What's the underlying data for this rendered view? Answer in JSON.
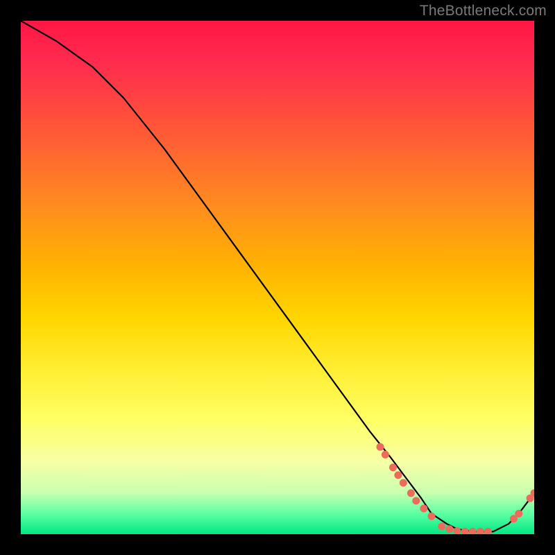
{
  "watermark": "TheBottleneck.com",
  "colors": {
    "dot": "#ec6b5a",
    "line": "#000000",
    "background": "#000000"
  },
  "chart_data": {
    "type": "line",
    "title": "",
    "xlabel": "",
    "ylabel": "",
    "xlim": [
      0,
      100
    ],
    "ylim": [
      0,
      100
    ],
    "grid": false,
    "legend": null,
    "series": [
      {
        "name": "curve",
        "x": [
          0,
          7,
          14,
          20,
          28,
          36,
          44,
          52,
          60,
          68,
          72,
          75,
          78,
          80,
          83,
          85,
          88,
          90,
          92,
          95,
          97,
          100
        ],
        "y": [
          100,
          96,
          91,
          85,
          75,
          64,
          53,
          42,
          31,
          20,
          15,
          11,
          7,
          4,
          2,
          1,
          0.5,
          0.5,
          0.5,
          2,
          4,
          8
        ]
      }
    ],
    "dots": [
      {
        "x": 70,
        "y": 17
      },
      {
        "x": 71,
        "y": 15.5
      },
      {
        "x": 72.5,
        "y": 13
      },
      {
        "x": 73.5,
        "y": 11.5
      },
      {
        "x": 74.5,
        "y": 10
      },
      {
        "x": 76,
        "y": 8
      },
      {
        "x": 77,
        "y": 6.5
      },
      {
        "x": 78.5,
        "y": 5
      },
      {
        "x": 80,
        "y": 3.5
      },
      {
        "x": 82,
        "y": 1.5
      },
      {
        "x": 83.5,
        "y": 1
      },
      {
        "x": 85,
        "y": 0.6
      },
      {
        "x": 86.5,
        "y": 0.5
      },
      {
        "x": 88,
        "y": 0.5
      },
      {
        "x": 89.5,
        "y": 0.5
      },
      {
        "x": 91,
        "y": 0.5
      },
      {
        "x": 96,
        "y": 3
      },
      {
        "x": 97,
        "y": 4
      },
      {
        "x": 99.2,
        "y": 7
      },
      {
        "x": 100,
        "y": 8
      }
    ],
    "dot_radius_px": 5.5
  }
}
